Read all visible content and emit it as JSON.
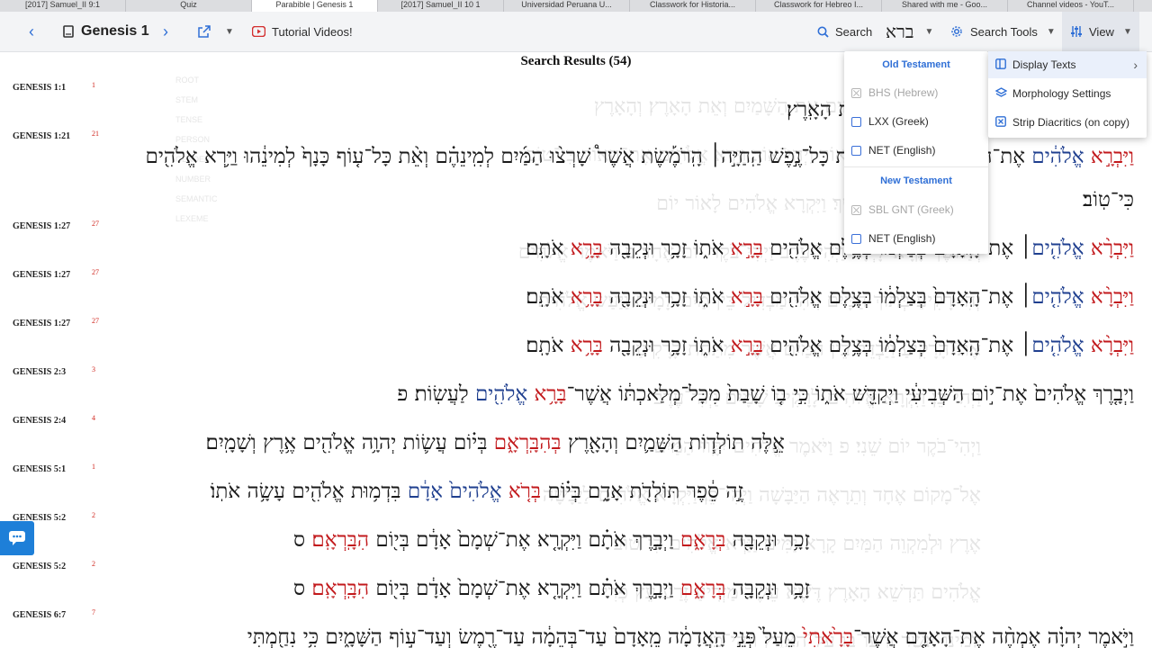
{
  "tabs": [
    {
      "label": "[2017] Samuel_II 9:1",
      "active": false
    },
    {
      "label": "Quiz",
      "active": false
    },
    {
      "label": "Parabible | Genesis 1",
      "active": true
    },
    {
      "label": "[2017] Samuel_II 10 1",
      "active": false
    },
    {
      "label": "Universidad Peruana U...",
      "active": false
    },
    {
      "label": "Classwork for Historia...",
      "active": false
    },
    {
      "label": "Classwork for Hebreo I...",
      "active": false
    },
    {
      "label": "Shared with me - Goo...",
      "active": false
    },
    {
      "label": "Channel videos - YouT...",
      "active": false
    }
  ],
  "toolbar": {
    "back_icon": "chevron-left-icon",
    "book_icon": "book-icon",
    "book_title": "Genesis 1",
    "tutorial_label": "Tutorial Videos!",
    "search_label": "Search",
    "search_term": "ברא",
    "search_tools_label": "Search Tools",
    "view_label": "View"
  },
  "results": {
    "title": "Search Results (54)"
  },
  "verses": [
    {
      "ref": "GENESIS 1:1",
      "num": "1",
      "html": "בְּרֵאשִׁ֖ית <span class=\"hit\">בָּרָ֣א</span> אֱלֹהִ֑ים אֵ֥ת הַשָּׁמַ֖יִם וְאֵ֥ת הָאָֽרֶץ׃"
    },
    {
      "ref": "GENESIS 1:21",
      "num": "21",
      "wrap": true,
      "html": "<span class=\"hit\">וַיִּבְרָ֣א</span> <span class=\"blue\">אֱלֹהִ֔ים</span> אֶת־הַתַּנִּינִ֖ם הַגְּדֹלִ֑ים וְאֵ֣ת כָּל־נֶ֣פֶשׁ הַֽחַיָּ֣ה׀ הָֽרֹמֶ֡שֶׂת אֲשֶׁר֩ שָׁרְצ֨וּ הַמַּ֜יִם לְמִֽינֵהֶ֗ם וְאֵ֨ת כָּל־ע֤וֹף כָּנָף֙ לְמִינֵ֔הוּ וַיַּ֥רְא אֱלֹהִ֖ים כִּי־טֽוֹב׃"
    },
    {
      "ref": "GENESIS 1:27",
      "num": "27",
      "html": "<span class=\"hit\">וַיִּבְרָ֨א</span> <span class=\"blue\">אֱלֹהִ֤ים</span>׀ אֶת־הָֽאָדָם֙ בְּצַלְמ֔וֹ בְּצֶ֥לֶם אֱלֹהִ֖ים <span class=\"hit\">בָּרָ֣א</span> אֹת֑וֹ זָכָ֥ר וּנְקֵבָ֖ה <span class=\"hit\">בָּרָ֥א</span> אֹתָֽם׃"
    },
    {
      "ref": "GENESIS 1:27",
      "num": "27",
      "html": "<span class=\"hit\">וַיִּבְרָ֨א</span> <span class=\"blue\">אֱלֹהִ֤ים</span>׀ אֶת־הָֽאָדָם֙ בְּצַלְמ֔וֹ בְּצֶ֥לֶם אֱלֹהִ֖ים <span class=\"hit\">בָּרָ֣א</span> אֹת֑וֹ זָכָ֥ר וּנְקֵבָ֖ה <span class=\"hit\">בָּרָ֥א</span> אֹתָֽם׃"
    },
    {
      "ref": "GENESIS 1:27",
      "num": "27",
      "html": "<span class=\"hit\">וַיִּבְרָ֨א</span> <span class=\"blue\">אֱלֹהִ֤ים</span>׀ אֶת־הָֽאָדָם֙ בְּצַלְמ֔וֹ בְּצֶ֥לֶם אֱלֹהִ֖ים <span class=\"hit\">בָּרָ֣א</span> אֹת֑וֹ זָכָ֥ר וּנְקֵבָ֖ה <span class=\"hit\">בָּרָ֥א</span> אֹתָֽם׃"
    },
    {
      "ref": "GENESIS 2:3",
      "num": "3",
      "html": "וַיְבָ֤רֶךְ אֱלֹהִים֙ אֶת־י֣וֹם הַשְּׁבִיעִ֔י וַיְקַדֵּ֖שׁ אֹת֑וֹ כִּ֣י ב֤וֹ שָׁבַת֙ מִכָּל־מְלַאכְתּ֔וֹ אֲשֶׁר־<span class=\"hit\">בָּרָ֥א</span> <span class=\"blue\">אֱלֹהִ֖ים</span> לַעֲשֽׂוֹת׃ פ"
    },
    {
      "ref": "GENESIS 2:4",
      "num": "4",
      "html": "אֵ֣לֶּה תוֹלְד֧וֹת הַשָּׁמַ֛יִם וְהָאָ֖רֶץ <span class=\"hit\">בְּהִבָּֽרְאָ֑ם</span> בְּי֗וֹם עֲשׂ֛וֹת יְהוָ֥ה אֱלֹהִ֖ים אֶ֥רֶץ וְשָׁמָֽיִם׃"
    },
    {
      "ref": "GENESIS 5:1",
      "num": "1",
      "html": "זֶ֣ה סֵ֔פֶר תּוֹלְדֹ֖ת אָדָ֑ם בְּי֗וֹם <span class=\"hit\">בְּרֹ֤א</span> <span class=\"blue\">אֱלֹהִים֙ אָדָ֔ם</span> בִּדְמ֥וּת אֱלֹהִ֖ים עָשָׂ֥ה אֹתֽוֹ׃"
    },
    {
      "ref": "GENESIS 5:2",
      "num": "2",
      "html": "זָכָ֥ר וּנְקֵבָ֖ה <span class=\"hit\">בְּרָאָ֑ם</span> וַיְבָ֣רֶךְ אֹתָ֗ם וַיִּקְרָ֤א אֶת־שְׁמָם֙ אָדָ֔ם בְּי֖וֹם <span class=\"hit\">הִבָּֽרְאָֽם׃</span> ס"
    },
    {
      "ref": "GENESIS 5:2",
      "num": "2",
      "html": "זָכָ֥ר וּנְקֵבָ֖ה <span class=\"hit\">בְּרָאָ֑ם</span> וַיְבָ֣רֶךְ אֹתָ֗ם וַיִּקְרָ֤א אֶת־שְׁמָם֙ אָדָ֔ם בְּי֖וֹם <span class=\"hit\">הִבָּֽרְאָֽם׃</span> ס"
    },
    {
      "ref": "GENESIS 6:7",
      "num": "7",
      "html": "וַיֹּ֣אמֶר יְהוָ֗ה אֶמְחֶ֨ה אֶת־הָאָדָ֤ם אֲשֶׁר־<span class=\"hit\">בָּרָ֙אתִי֙</span> מֵעַל֙ פְּנֵ֣י הָֽאֲדָמָ֔ה מֵֽאָדָם֙ עַד־בְּהֵמָ֔ה עַד־רֶ֖מֶשׂ וְעַד־ע֣וֹף הַשָּׁמָ֑יִם כִּ֥י נִחַ֖מְתִּי"
    }
  ],
  "texts_menu": {
    "ot_header": "Old Testament",
    "ot_items": [
      {
        "label": "BHS (Hebrew)",
        "disabled": true
      },
      {
        "label": "LXX (Greek)",
        "disabled": false
      },
      {
        "label": "NET (English)",
        "disabled": false
      }
    ],
    "nt_header": "New Testament",
    "nt_items": [
      {
        "label": "SBL GNT (Greek)",
        "disabled": true
      },
      {
        "label": "NET (English)",
        "disabled": false
      }
    ]
  },
  "view_menu": [
    {
      "label": "Display Texts",
      "icon": "columns-icon",
      "has_submenu": true
    },
    {
      "label": "Morphology Settings",
      "icon": "layers-icon",
      "has_submenu": false
    },
    {
      "label": "Strip Diacritics (on copy)",
      "icon": "strip-icon",
      "has_submenu": false
    }
  ],
  "colors": {
    "hit": "#c2191c",
    "subject": "#1f3f8f",
    "accent": "#2f6fd6"
  }
}
